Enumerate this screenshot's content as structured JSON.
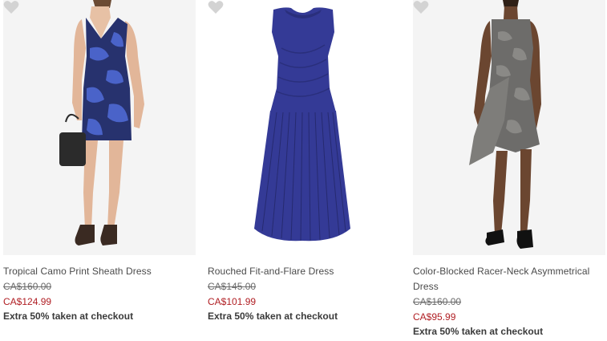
{
  "products": [
    {
      "name": "Tropical Camo Print Sheath Dress",
      "original_price": "CA$160.00",
      "sale_price": "CA$124.99",
      "promo": "Extra 50% taken at checkout",
      "dress_color": "#27326e",
      "pattern_color": "#4a63c9"
    },
    {
      "name": "Rouched Fit-and-Flare Dress",
      "original_price": "CA$145.00",
      "sale_price": "CA$101.99",
      "promo": "Extra 50% taken at checkout",
      "dress_color": "#343a96"
    },
    {
      "name": "Color-Blocked Racer-Neck Asymmetrical Dress",
      "original_price": "CA$160.00",
      "sale_price": "CA$95.99",
      "promo": "Extra 50% taken at checkout",
      "dress_color": "#6d6c6a",
      "pattern_color": "#8a8986"
    }
  ],
  "icons": {
    "favorite": "heart-icon"
  },
  "colors": {
    "sale_price": "#b01e23",
    "strike_price": "#6a6a6a",
    "favorite_icon": "#d3d3d3"
  }
}
